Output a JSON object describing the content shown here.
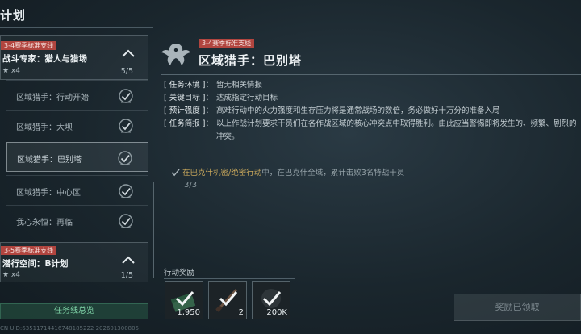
{
  "page": {
    "title": "计划"
  },
  "sidebar": {
    "groups": [
      {
        "tag": "3-4赛季标准支线",
        "title": "战斗专家：猎人与猎场",
        "stars": "★ x4",
        "count": "5/5"
      },
      {
        "tag": "3-5赛季标准支线",
        "title": "潜行空间：B计划",
        "stars": "★ x4",
        "count": "1/5"
      }
    ],
    "tasks": [
      {
        "label": "区域猎手：行动开始"
      },
      {
        "label": "区域猎手：大坝"
      },
      {
        "label": "区域猎手：巴别塔"
      },
      {
        "label": "区域猎手：中心区"
      },
      {
        "label": "我心永恒：再临"
      }
    ],
    "overview_button": "任务线总览"
  },
  "detail": {
    "tag": "3-4赛季标准支线",
    "title": "区域猎手：巴别塔",
    "info": [
      {
        "key": "[ 任务环境 ]：",
        "value": "暂无相关情报"
      },
      {
        "key": "[ 关键目标 ]：",
        "value": "达成指定行动目标"
      },
      {
        "key": "[ 预计强度 ]：",
        "value": "高难行动中的火力强度和生存压力将是通常战场的数倍，务必做好十万分的准备入局"
      },
      {
        "key": "[ 任务简报 ]：",
        "value": "以上作战计划要求干员们在各作战区域的核心冲突点中取得胜利。由此应当警惕即将发生的、频繁、剧烈的冲突。"
      }
    ],
    "objective": {
      "highlight": "在巴克什机密/绝密行动",
      "rest": "中，在巴克什全域，累计击败3名特战干员",
      "progress": "3/3"
    }
  },
  "rewards": {
    "label": "行动奖励",
    "items": [
      {
        "icon": "money-stack-icon",
        "amount": "1,950"
      },
      {
        "icon": "blade-item-icon",
        "amount": "2"
      },
      {
        "icon": "experience-icon",
        "amount": "200K"
      }
    ],
    "claimed_button": "奖励已领取"
  },
  "footer": {
    "uid": "CN UID:63511714416748185222 202601300805"
  },
  "colors": {
    "accent_green": "#7fd3a7",
    "tag_red": "#b1453f",
    "objective_gold": "#c9a85c"
  }
}
